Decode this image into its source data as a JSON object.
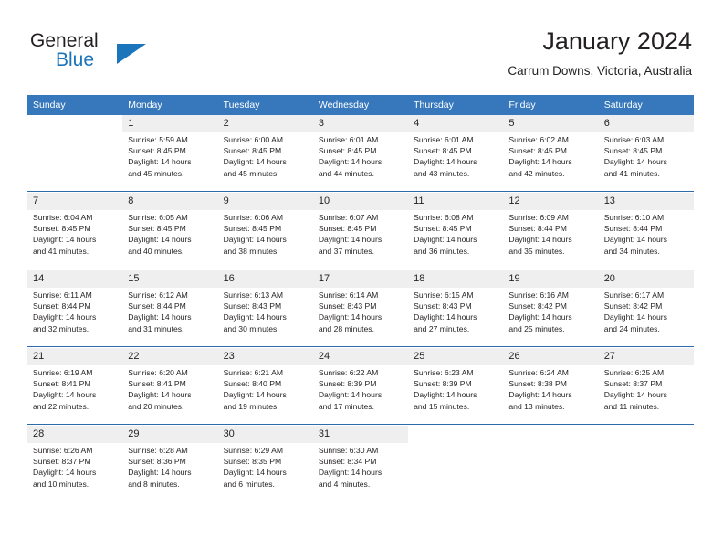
{
  "brand": {
    "name_part1": "General",
    "name_part2": "Blue",
    "logo_icon": "triangle-icon",
    "accent_color": "#1b75bb"
  },
  "header": {
    "title": "January 2024",
    "subtitle": "Carrum Downs, Victoria, Australia"
  },
  "calendar": {
    "header_bg_color": "#3777bc",
    "daynum_bg_color": "#efefef",
    "week_separator_color": "#2f6ba8",
    "weekday_headers": [
      "Sunday",
      "Monday",
      "Tuesday",
      "Wednesday",
      "Thursday",
      "Friday",
      "Saturday"
    ],
    "weeks": [
      [
        {
          "day": "",
          "sunrise": "",
          "sunset": "",
          "daylight1": "",
          "daylight2": ""
        },
        {
          "day": "1",
          "sunrise": "Sunrise: 5:59 AM",
          "sunset": "Sunset: 8:45 PM",
          "daylight1": "Daylight: 14 hours",
          "daylight2": "and 45 minutes."
        },
        {
          "day": "2",
          "sunrise": "Sunrise: 6:00 AM",
          "sunset": "Sunset: 8:45 PM",
          "daylight1": "Daylight: 14 hours",
          "daylight2": "and 45 minutes."
        },
        {
          "day": "3",
          "sunrise": "Sunrise: 6:01 AM",
          "sunset": "Sunset: 8:45 PM",
          "daylight1": "Daylight: 14 hours",
          "daylight2": "and 44 minutes."
        },
        {
          "day": "4",
          "sunrise": "Sunrise: 6:01 AM",
          "sunset": "Sunset: 8:45 PM",
          "daylight1": "Daylight: 14 hours",
          "daylight2": "and 43 minutes."
        },
        {
          "day": "5",
          "sunrise": "Sunrise: 6:02 AM",
          "sunset": "Sunset: 8:45 PM",
          "daylight1": "Daylight: 14 hours",
          "daylight2": "and 42 minutes."
        },
        {
          "day": "6",
          "sunrise": "Sunrise: 6:03 AM",
          "sunset": "Sunset: 8:45 PM",
          "daylight1": "Daylight: 14 hours",
          "daylight2": "and 41 minutes."
        }
      ],
      [
        {
          "day": "7",
          "sunrise": "Sunrise: 6:04 AM",
          "sunset": "Sunset: 8:45 PM",
          "daylight1": "Daylight: 14 hours",
          "daylight2": "and 41 minutes."
        },
        {
          "day": "8",
          "sunrise": "Sunrise: 6:05 AM",
          "sunset": "Sunset: 8:45 PM",
          "daylight1": "Daylight: 14 hours",
          "daylight2": "and 40 minutes."
        },
        {
          "day": "9",
          "sunrise": "Sunrise: 6:06 AM",
          "sunset": "Sunset: 8:45 PM",
          "daylight1": "Daylight: 14 hours",
          "daylight2": "and 38 minutes."
        },
        {
          "day": "10",
          "sunrise": "Sunrise: 6:07 AM",
          "sunset": "Sunset: 8:45 PM",
          "daylight1": "Daylight: 14 hours",
          "daylight2": "and 37 minutes."
        },
        {
          "day": "11",
          "sunrise": "Sunrise: 6:08 AM",
          "sunset": "Sunset: 8:45 PM",
          "daylight1": "Daylight: 14 hours",
          "daylight2": "and 36 minutes."
        },
        {
          "day": "12",
          "sunrise": "Sunrise: 6:09 AM",
          "sunset": "Sunset: 8:44 PM",
          "daylight1": "Daylight: 14 hours",
          "daylight2": "and 35 minutes."
        },
        {
          "day": "13",
          "sunrise": "Sunrise: 6:10 AM",
          "sunset": "Sunset: 8:44 PM",
          "daylight1": "Daylight: 14 hours",
          "daylight2": "and 34 minutes."
        }
      ],
      [
        {
          "day": "14",
          "sunrise": "Sunrise: 6:11 AM",
          "sunset": "Sunset: 8:44 PM",
          "daylight1": "Daylight: 14 hours",
          "daylight2": "and 32 minutes."
        },
        {
          "day": "15",
          "sunrise": "Sunrise: 6:12 AM",
          "sunset": "Sunset: 8:44 PM",
          "daylight1": "Daylight: 14 hours",
          "daylight2": "and 31 minutes."
        },
        {
          "day": "16",
          "sunrise": "Sunrise: 6:13 AM",
          "sunset": "Sunset: 8:43 PM",
          "daylight1": "Daylight: 14 hours",
          "daylight2": "and 30 minutes."
        },
        {
          "day": "17",
          "sunrise": "Sunrise: 6:14 AM",
          "sunset": "Sunset: 8:43 PM",
          "daylight1": "Daylight: 14 hours",
          "daylight2": "and 28 minutes."
        },
        {
          "day": "18",
          "sunrise": "Sunrise: 6:15 AM",
          "sunset": "Sunset: 8:43 PM",
          "daylight1": "Daylight: 14 hours",
          "daylight2": "and 27 minutes."
        },
        {
          "day": "19",
          "sunrise": "Sunrise: 6:16 AM",
          "sunset": "Sunset: 8:42 PM",
          "daylight1": "Daylight: 14 hours",
          "daylight2": "and 25 minutes."
        },
        {
          "day": "20",
          "sunrise": "Sunrise: 6:17 AM",
          "sunset": "Sunset: 8:42 PM",
          "daylight1": "Daylight: 14 hours",
          "daylight2": "and 24 minutes."
        }
      ],
      [
        {
          "day": "21",
          "sunrise": "Sunrise: 6:19 AM",
          "sunset": "Sunset: 8:41 PM",
          "daylight1": "Daylight: 14 hours",
          "daylight2": "and 22 minutes."
        },
        {
          "day": "22",
          "sunrise": "Sunrise: 6:20 AM",
          "sunset": "Sunset: 8:41 PM",
          "daylight1": "Daylight: 14 hours",
          "daylight2": "and 20 minutes."
        },
        {
          "day": "23",
          "sunrise": "Sunrise: 6:21 AM",
          "sunset": "Sunset: 8:40 PM",
          "daylight1": "Daylight: 14 hours",
          "daylight2": "and 19 minutes."
        },
        {
          "day": "24",
          "sunrise": "Sunrise: 6:22 AM",
          "sunset": "Sunset: 8:39 PM",
          "daylight1": "Daylight: 14 hours",
          "daylight2": "and 17 minutes."
        },
        {
          "day": "25",
          "sunrise": "Sunrise: 6:23 AM",
          "sunset": "Sunset: 8:39 PM",
          "daylight1": "Daylight: 14 hours",
          "daylight2": "and 15 minutes."
        },
        {
          "day": "26",
          "sunrise": "Sunrise: 6:24 AM",
          "sunset": "Sunset: 8:38 PM",
          "daylight1": "Daylight: 14 hours",
          "daylight2": "and 13 minutes."
        },
        {
          "day": "27",
          "sunrise": "Sunrise: 6:25 AM",
          "sunset": "Sunset: 8:37 PM",
          "daylight1": "Daylight: 14 hours",
          "daylight2": "and 11 minutes."
        }
      ],
      [
        {
          "day": "28",
          "sunrise": "Sunrise: 6:26 AM",
          "sunset": "Sunset: 8:37 PM",
          "daylight1": "Daylight: 14 hours",
          "daylight2": "and 10 minutes."
        },
        {
          "day": "29",
          "sunrise": "Sunrise: 6:28 AM",
          "sunset": "Sunset: 8:36 PM",
          "daylight1": "Daylight: 14 hours",
          "daylight2": "and 8 minutes."
        },
        {
          "day": "30",
          "sunrise": "Sunrise: 6:29 AM",
          "sunset": "Sunset: 8:35 PM",
          "daylight1": "Daylight: 14 hours",
          "daylight2": "and 6 minutes."
        },
        {
          "day": "31",
          "sunrise": "Sunrise: 6:30 AM",
          "sunset": "Sunset: 8:34 PM",
          "daylight1": "Daylight: 14 hours",
          "daylight2": "and 4 minutes."
        },
        {
          "day": "",
          "sunrise": "",
          "sunset": "",
          "daylight1": "",
          "daylight2": ""
        },
        {
          "day": "",
          "sunrise": "",
          "sunset": "",
          "daylight1": "",
          "daylight2": ""
        },
        {
          "day": "",
          "sunrise": "",
          "sunset": "",
          "daylight1": "",
          "daylight2": ""
        }
      ]
    ]
  }
}
